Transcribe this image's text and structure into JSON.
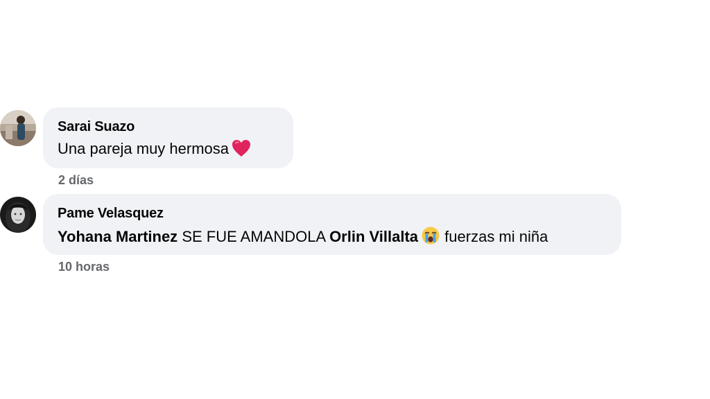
{
  "comments": [
    {
      "author": "Sarai Suazo",
      "text": "Una pareja muy hermosa",
      "emoji": "red-heart-icon",
      "time": "2 días",
      "avatar_icon": "user-photo-avatar"
    },
    {
      "author": "Pame Velasquez",
      "mention1": "Yohana Martinez",
      "text_mid": "SE FUE AMANDOLA",
      "mention2": "Orlin Villalta",
      "emoji": "crying-face-icon",
      "text_end": "fuerzas mi niña",
      "time": "10 horas",
      "avatar_icon": "user-photo-avatar"
    }
  ],
  "colors": {
    "bubble_bg": "#f0f2f5",
    "meta_text": "#65676b",
    "heart": "#e0245e"
  }
}
